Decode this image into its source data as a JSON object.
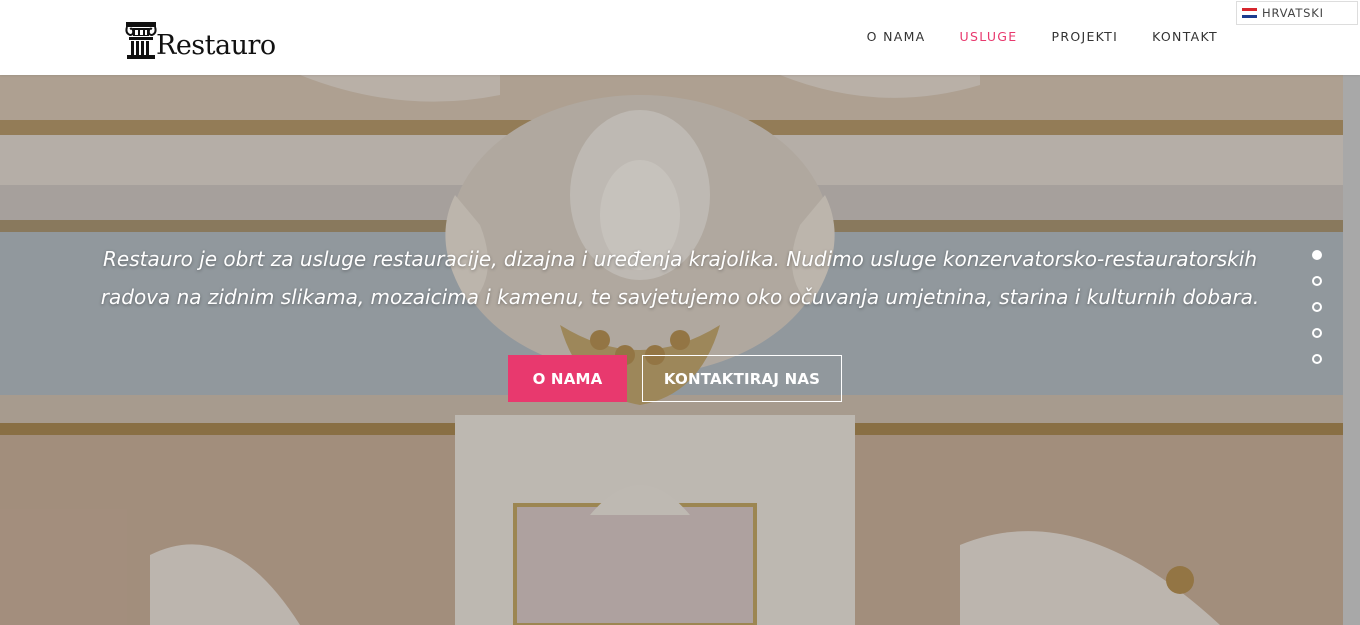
{
  "brand": {
    "name": "Restauro",
    "logo_icon": "column-capital-icon"
  },
  "nav": {
    "items": [
      {
        "label": "O NAMA",
        "active": false
      },
      {
        "label": "USLUGE",
        "active": true
      },
      {
        "label": "PROJEKTI",
        "active": false
      },
      {
        "label": "KONTAKT",
        "active": false
      }
    ],
    "active_color": "#e8396e"
  },
  "language": {
    "label": "HRVATSKI",
    "flag_icon": "croatia-flag-icon"
  },
  "hero": {
    "text": "Restauro je obrt za usluge restauracije, dizajna i uređenja krajolika. Nudimo usluge konzervatorsko-restauratorskih radova na zidnim slikama, mozaicima i kamenu, te savjetujemo oko očuvanja umjetnina, starina i kulturnih dobara.",
    "primary_button": "O NAMA",
    "secondary_button": "KONTAKTIRAJ NAS",
    "slides": {
      "count": 5,
      "active_index": 0
    },
    "accent_color": "#e8396e"
  }
}
